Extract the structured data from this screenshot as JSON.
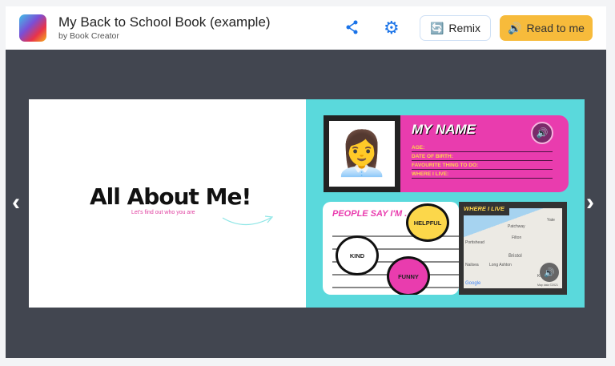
{
  "header": {
    "title": "My Back to School Book (example)",
    "byline": "by Book Creator",
    "remix_label": "Remix",
    "read_label": "Read to me",
    "accent": "#1a73e8",
    "read_color": "#f7bb3b"
  },
  "book": {
    "left_page": {
      "title": "All About Me!",
      "subtitle": "Let's find out who you are"
    },
    "right_page": {
      "name_heading": "MY NAME",
      "fields": [
        "AGE:",
        "DATE OF BIRTH:",
        "FAVOURITE THING TO DO:",
        "WHERE I LIVE:"
      ],
      "people_say": "PEOPLE SAY I'M . . .",
      "bubbles": [
        "HELPFUL",
        "KIND",
        "FUNNY"
      ],
      "where_i_live": "WHERE I LIVE",
      "map_labels": [
        "Portishead",
        "Patchway",
        "Filton",
        "Bristol",
        "Nailsea",
        "Long Ashton",
        "Keynsham",
        "Yate",
        "Google",
        "Map data ©2021"
      ]
    },
    "colors": {
      "teal": "#5ad9dc",
      "pink": "#e93cae",
      "yellow": "#ffd54a"
    }
  }
}
